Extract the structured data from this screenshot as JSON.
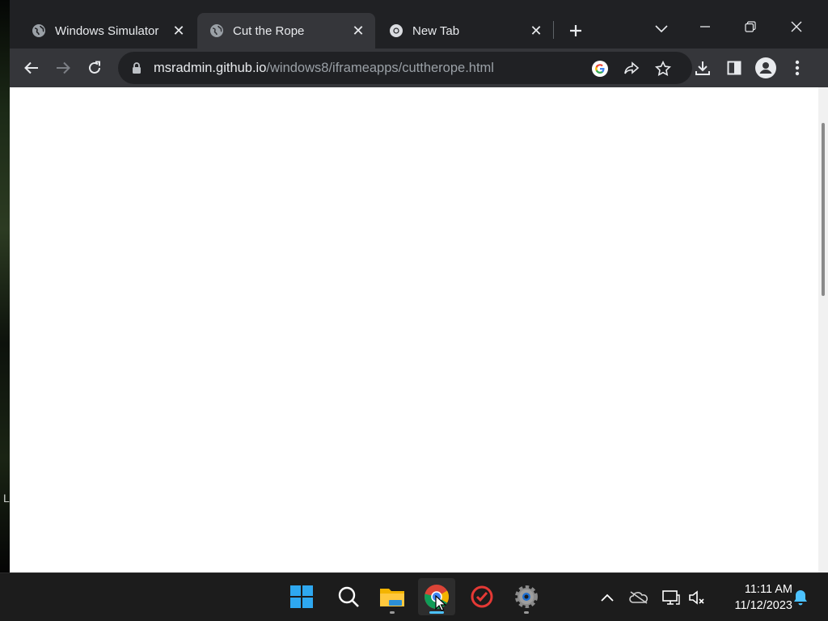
{
  "browser": {
    "tabs": [
      {
        "title": "Windows Simulator",
        "icon": "globe-icon",
        "active": false
      },
      {
        "title": "Cut the Rope",
        "icon": "globe-icon",
        "active": true
      },
      {
        "title": "New Tab",
        "icon": "chrome-icon",
        "active": false
      }
    ],
    "address_bar": {
      "host": "msradmin.github.io",
      "path": "/windows8/iframeapps/cuttherope.html"
    },
    "toolbar_icons": [
      "back-icon",
      "forward-icon",
      "reload-icon",
      "lock-icon",
      "google-icon",
      "share-icon",
      "star-icon",
      "download-icon",
      "side-panel-icon",
      "profile-icon",
      "menu-icon"
    ]
  },
  "desktop": {
    "edge_glyph": "L"
  },
  "taskbar": {
    "apps": [
      "start-icon",
      "search-icon",
      "file-explorer-icon",
      "chrome-icon",
      "red-app-icon",
      "settings-icon"
    ],
    "tray_icons": [
      "chevron-up-icon",
      "onedrive-icon",
      "network-icon",
      "volume-muted-icon",
      "notification-bell-icon"
    ],
    "time": "11:11 AM",
    "date": "11/12/2023"
  },
  "colors": {
    "taskbar_accent": "#4cc2ff",
    "chrome_dark": "#202124",
    "chrome_toolbar": "#35363a"
  }
}
